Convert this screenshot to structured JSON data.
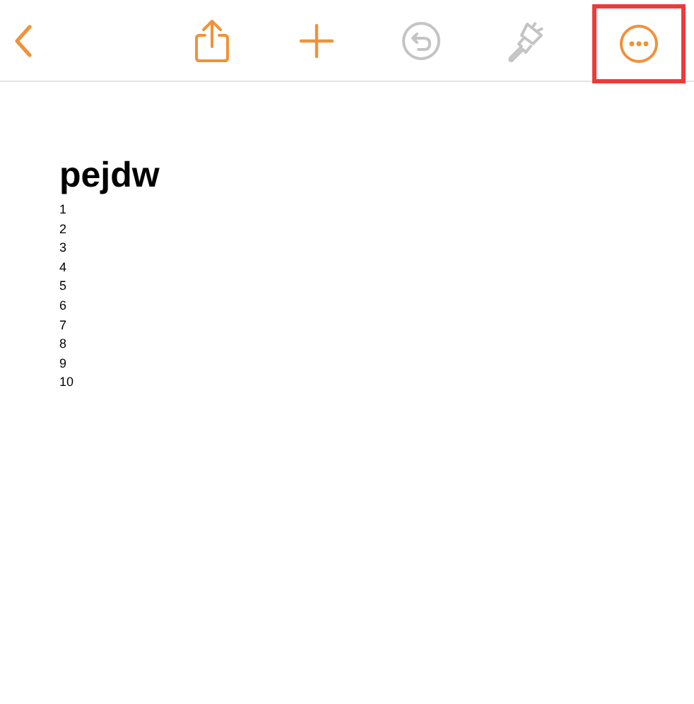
{
  "toolbar": {
    "items": [
      {
        "kind": "back",
        "disabled": false,
        "highlighted": false
      },
      {
        "kind": "share",
        "disabled": false,
        "highlighted": false
      },
      {
        "kind": "add",
        "disabled": false,
        "highlighted": false
      },
      {
        "kind": "undo",
        "disabled": true,
        "highlighted": false
      },
      {
        "kind": "brush",
        "disabled": true,
        "highlighted": false
      },
      {
        "kind": "more",
        "disabled": false,
        "highlighted": true
      }
    ]
  },
  "document": {
    "title": "pejdw",
    "lines": [
      "1",
      "2",
      "3",
      "4",
      "5",
      "6",
      "7",
      "8",
      "9",
      "10"
    ]
  }
}
